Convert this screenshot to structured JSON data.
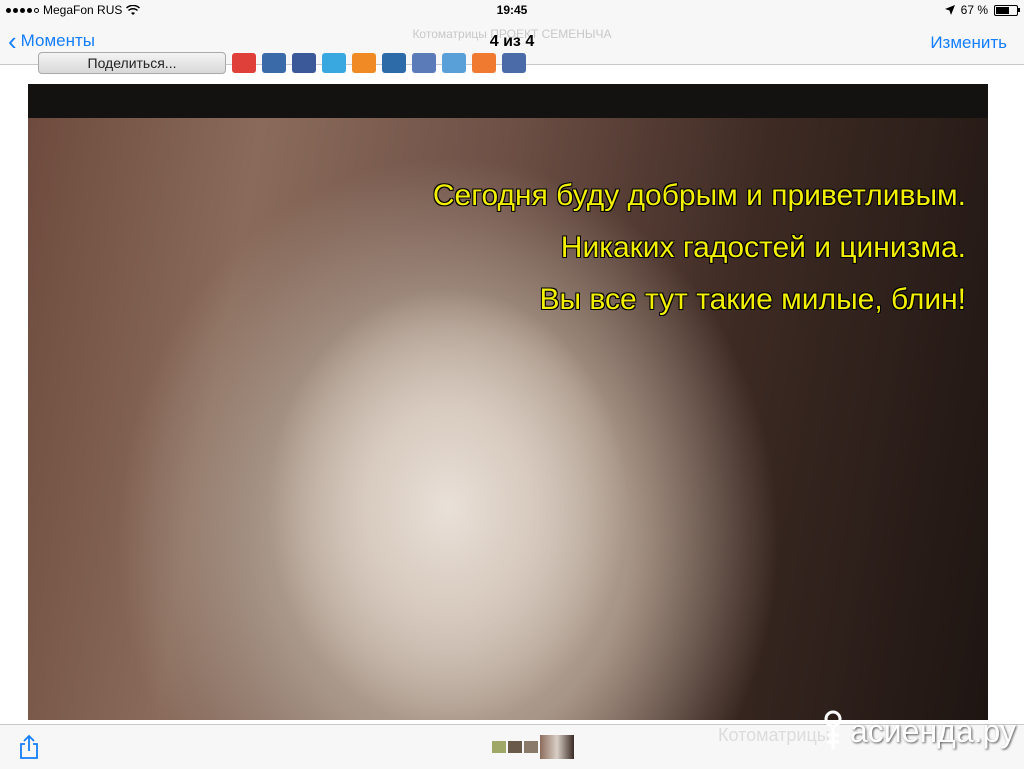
{
  "status_bar": {
    "carrier": "MegaFon RUS",
    "time": "19:45",
    "battery_text": "67 %",
    "battery_level": 0.67
  },
  "nav": {
    "back_label": "Моменты",
    "ghost_title": "Котоматрицы ПРОЕКТ СЕМЕНЫЧА",
    "title": "4 из 4",
    "edit_label": "Изменить"
  },
  "share_strip": {
    "button_label": "Поделиться..."
  },
  "photo": {
    "caption_lines": [
      "Сегодня буду добрым и приветливым.",
      "Никаких гадостей и цинизма.",
      "Вы все тут такие милые, блин!"
    ]
  },
  "bottom": {
    "ghost_text": "Котоматрицы",
    "watermark": "асиенда.ру"
  },
  "colors": {
    "accent": "#147efb",
    "caption": "#f2f000"
  },
  "icons": [
    "wifi-icon",
    "location-arrow-icon",
    "chevron-left-icon",
    "share-icon"
  ]
}
